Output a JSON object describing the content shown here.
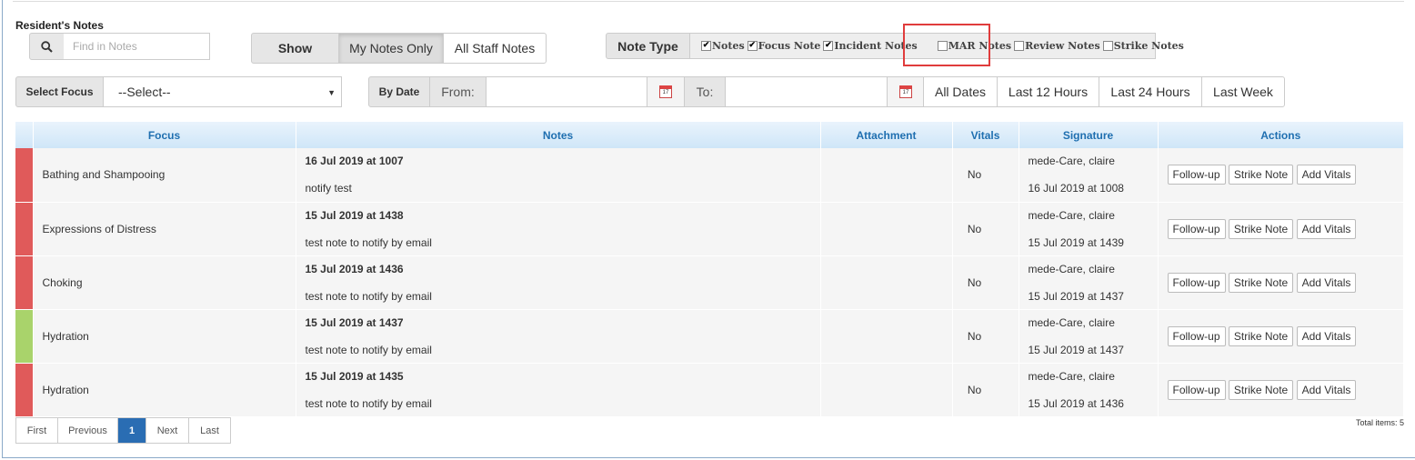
{
  "section_title": "Resident's Notes",
  "search": {
    "placeholder": "Find in  Notes",
    "icon": "search-icon"
  },
  "show": {
    "label": "Show",
    "options": [
      "My Notes Only",
      "All Staff Notes"
    ],
    "selected": "My Notes Only"
  },
  "note_type": {
    "label": "Note Type",
    "options": [
      {
        "label": "Notes",
        "checked": true
      },
      {
        "label": "Focus Note",
        "checked": true
      },
      {
        "label": "Incident Notes",
        "checked": true
      },
      {
        "label": "MAR Notes",
        "checked": false
      },
      {
        "label": "Review Notes",
        "checked": false
      },
      {
        "label": "Strike Notes",
        "checked": false
      }
    ]
  },
  "select_focus": {
    "label": "Select Focus",
    "value": "--Select--"
  },
  "by_date": {
    "label": "By Date",
    "from_label": "From:",
    "to_label": "To:",
    "buttons": [
      "All Dates",
      "Last 12 Hours",
      "Last 24 Hours",
      "Last Week"
    ]
  },
  "table": {
    "headers": [
      "Focus",
      "Notes",
      "Attachment",
      "Vitals",
      "Signature",
      "Actions"
    ],
    "rows": [
      {
        "color": "#e05a5a",
        "focus": "Bathing and Shampooing",
        "date": "16 Jul 2019 at 1007",
        "note": "notify test",
        "attachment": "",
        "vitals": "No",
        "sig_name": "mede-Care, claire",
        "sig_date": "16 Jul 2019 at 1008"
      },
      {
        "color": "#e05a5a",
        "focus": "Expressions of Distress",
        "date": "15 Jul 2019 at 1438",
        "note": "test note to notify by email",
        "attachment": "",
        "vitals": "No",
        "sig_name": "mede-Care, claire",
        "sig_date": "15 Jul 2019 at 1439"
      },
      {
        "color": "#e05a5a",
        "focus": "Choking",
        "date": "15 Jul 2019 at 1436",
        "note": "test note to notify by email",
        "attachment": "",
        "vitals": "No",
        "sig_name": "mede-Care, claire",
        "sig_date": "15 Jul 2019 at 1437"
      },
      {
        "color": "#a9d36b",
        "focus": "Hydration",
        "date": "15 Jul 2019 at 1437",
        "note": "test note to notify by email",
        "attachment": "",
        "vitals": "No",
        "sig_name": "mede-Care, claire",
        "sig_date": "15 Jul 2019 at 1437"
      },
      {
        "color": "#e05a5a",
        "focus": "Hydration",
        "date": "15 Jul 2019 at 1435",
        "note": "test note to notify by email",
        "attachment": "",
        "vitals": "No",
        "sig_name": "mede-Care, claire",
        "sig_date": "15 Jul 2019 at 1436"
      }
    ],
    "action_labels": [
      "Follow-up",
      "Strike Note",
      "Add Vitals"
    ]
  },
  "pager": {
    "first": "First",
    "previous": "Previous",
    "current": "1",
    "next": "Next",
    "last": "Last"
  },
  "total_items": "Total items: 5",
  "colors": {
    "header_text": "#1f6fb0",
    "pager_active": "#2a6db3",
    "highlight_box": "#e03c3c"
  }
}
